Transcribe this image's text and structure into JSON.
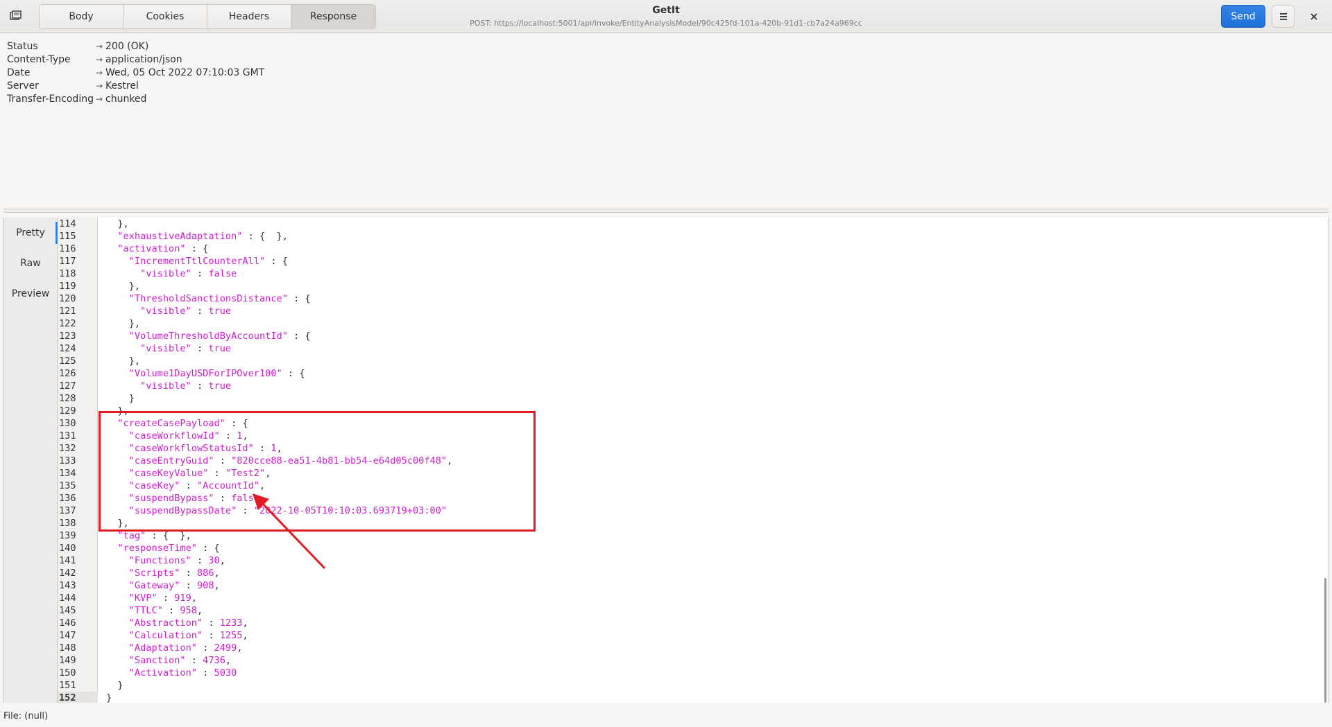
{
  "header": {
    "tabs": [
      "Body",
      "Cookies",
      "Headers",
      "Response"
    ],
    "active_tab": "Response",
    "title": "GetIt",
    "subtitle": "POST: https://localhost:5001/api/invoke/EntityAnalysisModel/90c425fd-101a-420b-91d1-cb7a24a969cc",
    "send_label": "Send",
    "menu_icon": "hamburger-menu-icon",
    "close_icon": "close-icon"
  },
  "response_headers": [
    {
      "key": "Status",
      "value": "200 (OK)"
    },
    {
      "key": "Content-Type",
      "value": "application/json"
    },
    {
      "key": "Date",
      "value": "Wed, 05 Oct 2022 07:10:03 GMT"
    },
    {
      "key": "Server",
      "value": "Kestrel"
    },
    {
      "key": "Transfer-Encoding",
      "value": "chunked"
    }
  ],
  "view_tabs": [
    "Pretty",
    "Raw",
    "Preview"
  ],
  "active_view": "Pretty",
  "code": {
    "current_line": 152,
    "lines": [
      {
        "n": 114,
        "t": "  },"
      },
      {
        "n": 115,
        "t": "  \"exhaustiveAdaptation\" : {  },"
      },
      {
        "n": 116,
        "t": "  \"activation\" : {"
      },
      {
        "n": 117,
        "t": "    \"IncrementTtlCounterAll\" : {"
      },
      {
        "n": 118,
        "t": "      \"visible\" : false"
      },
      {
        "n": 119,
        "t": "    },"
      },
      {
        "n": 120,
        "t": "    \"ThresholdSanctionsDistance\" : {"
      },
      {
        "n": 121,
        "t": "      \"visible\" : true"
      },
      {
        "n": 122,
        "t": "    },"
      },
      {
        "n": 123,
        "t": "    \"VolumeThresholdByAccountId\" : {"
      },
      {
        "n": 124,
        "t": "      \"visible\" : true"
      },
      {
        "n": 125,
        "t": "    },"
      },
      {
        "n": 126,
        "t": "    \"Volume1DayUSDForIPOver100\" : {"
      },
      {
        "n": 127,
        "t": "      \"visible\" : true"
      },
      {
        "n": 128,
        "t": "    }"
      },
      {
        "n": 129,
        "t": "  },"
      },
      {
        "n": 130,
        "t": "  \"createCasePayload\" : {"
      },
      {
        "n": 131,
        "t": "    \"caseWorkflowId\" : 1,"
      },
      {
        "n": 132,
        "t": "    \"caseWorkflowStatusId\" : 1,"
      },
      {
        "n": 133,
        "t": "    \"caseEntryGuid\" : \"820cce88-ea51-4b81-bb54-e64d05c00f48\","
      },
      {
        "n": 134,
        "t": "    \"caseKeyValue\" : \"Test2\","
      },
      {
        "n": 135,
        "t": "    \"caseKey\" : \"AccountId\","
      },
      {
        "n": 136,
        "t": "    \"suspendBypass\" : false,"
      },
      {
        "n": 137,
        "t": "    \"suspendBypassDate\" : \"2022-10-05T10:10:03.693719+03:00\""
      },
      {
        "n": 138,
        "t": "  },"
      },
      {
        "n": 139,
        "t": "  \"tag\" : {  },"
      },
      {
        "n": 140,
        "t": "  \"responseTime\" : {"
      },
      {
        "n": 141,
        "t": "    \"Functions\" : 30,"
      },
      {
        "n": 142,
        "t": "    \"Scripts\" : 886,"
      },
      {
        "n": 143,
        "t": "    \"Gateway\" : 908,"
      },
      {
        "n": 144,
        "t": "    \"KVP\" : 919,"
      },
      {
        "n": 145,
        "t": "    \"TTLC\" : 958,"
      },
      {
        "n": 146,
        "t": "    \"Abstraction\" : 1233,"
      },
      {
        "n": 147,
        "t": "    \"Calculation\" : 1255,"
      },
      {
        "n": 148,
        "t": "    \"Adaptation\" : 2499,"
      },
      {
        "n": 149,
        "t": "    \"Sanction\" : 4736,"
      },
      {
        "n": 150,
        "t": "    \"Activation\" : 5030"
      },
      {
        "n": 151,
        "t": "  }"
      },
      {
        "n": 152,
        "t": "}"
      }
    ]
  },
  "statusbar": {
    "text": "File: (null)"
  },
  "colors": {
    "json_token": "#d01dcf",
    "annotation": "#e01b24",
    "accent": "#3584e4"
  }
}
